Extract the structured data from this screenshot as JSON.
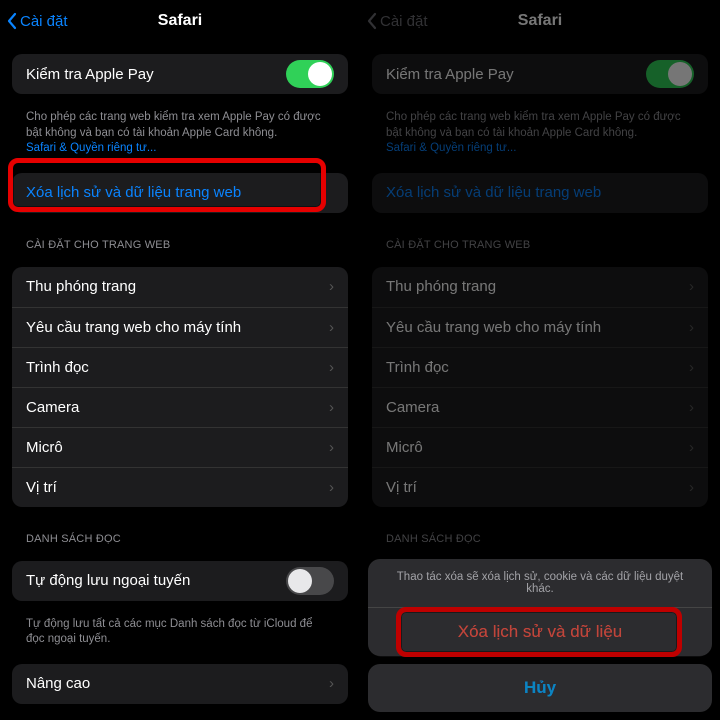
{
  "header": {
    "back": "Cài đặt",
    "title": "Safari"
  },
  "applePay": {
    "label": "Kiểm tra Apple Pay",
    "hint": "Cho phép các trang web kiểm tra xem Apple Pay có được bật không và bạn có tài khoản Apple Card không.",
    "privacyLink": "Safari & Quyền riêng tư..."
  },
  "clearHistory": "Xóa lịch sử và dữ liệu trang web",
  "webSettingsHeader": "CÀI ĐẶT CHO TRANG WEB",
  "webSettings": [
    "Thu phóng trang",
    "Yêu cầu trang web cho máy tính",
    "Trình đọc",
    "Camera",
    "Micrô",
    "Vị trí"
  ],
  "readingListHeader": "DANH SÁCH ĐỌC",
  "readingList": {
    "label": "Tự động lưu ngoại tuyến",
    "hint": "Tự động lưu tất cả các mục Danh sách đọc từ iCloud để đọc ngoại tuyến."
  },
  "advanced": "Nâng cao",
  "sheet": {
    "message": "Thao tác xóa sẽ xóa lịch sử, cookie và các dữ liệu duyệt khác.",
    "action": "Xóa lịch sử và dữ liệu",
    "cancel": "Hủy"
  }
}
